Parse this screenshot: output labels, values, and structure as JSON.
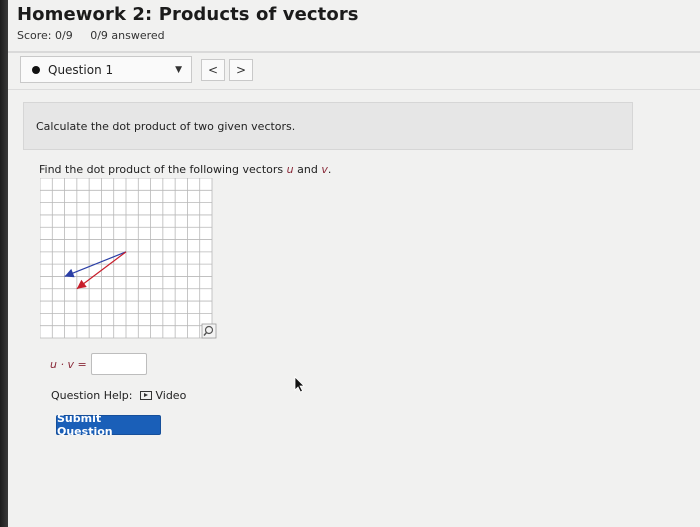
{
  "assignment": {
    "title": "Homework 2: Products of vectors",
    "score": "Score: 0/9",
    "answered": "0/9 answered"
  },
  "question_nav": {
    "selected": "Question 1",
    "prev_symbol": "<",
    "next_symbol": ">"
  },
  "prompt": {
    "text": "Calculate the dot product of two given vectors."
  },
  "question": {
    "text_before": "Find the dot product of the following vectors ",
    "vector_u": "u",
    "text_and": " and ",
    "vector_v": "v",
    "text_after": "."
  },
  "graph": {
    "grid_cols": 14,
    "grid_rows": 13,
    "vector_u_color": "#c81d2a",
    "vector_v_color": "#2b3fa6",
    "vector_u": {
      "from": [
        3,
        4
      ],
      "to": [
        7,
        7
      ]
    },
    "vector_v": {
      "from": [
        2,
        5
      ],
      "to": [
        7,
        7
      ]
    }
  },
  "answer": {
    "label": "u · v =",
    "value": ""
  },
  "help": {
    "label": "Question Help:",
    "video_label": "Video"
  },
  "submit": {
    "label": "Submit Question"
  },
  "colors": {
    "accent": "#1a5fb8",
    "vector_text": "#8a2b3a"
  }
}
